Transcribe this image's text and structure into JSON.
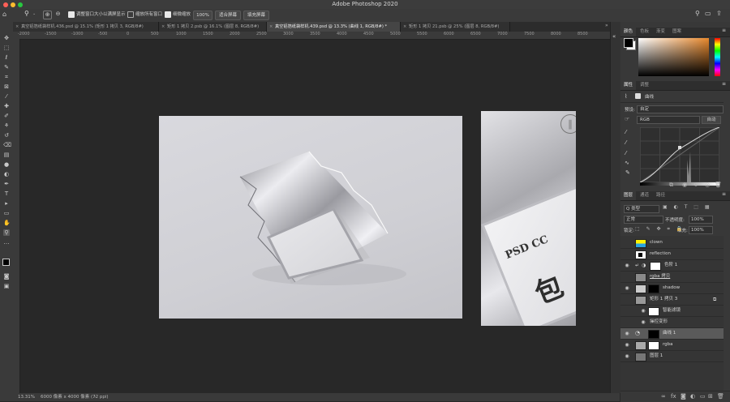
{
  "window": {
    "title": "Adobe Photoshop 2020"
  },
  "options_bar": {
    "resize_window_label": "调整窗口大小以满屏显示",
    "zoom_all_windows_label": "缩放所有窗口",
    "scrubby_zoom_label": "细微缩放",
    "zoom_value": "100%",
    "fit_screen_label": "适合屏幕",
    "fill_screen_label": "填充屏幕"
  },
  "tabs": [
    {
      "label": "真空铝箔纸袋样机.436.psd @ 15.1% (矩形 1 拷贝 3, RGB/8#)"
    },
    {
      "label": "矩形 1 拷贝 2.psb @ 16.1% (图层 8, RGB/8#)"
    },
    {
      "label": "真空铝箔纸袋样机.439.psd @ 13.3% (曲线 1, RGB/8#) *"
    },
    {
      "label": "矩形 1 拷贝 21.psb @ 25% (图层 8, RGB/8#)"
    }
  ],
  "ruler": {
    "top_ticks": [
      "-2000",
      "-1500",
      "-1000",
      "-500",
      "0",
      "500",
      "1000",
      "1500",
      "2000",
      "2500",
      "3000",
      "3500",
      "4000",
      "4500",
      "5000",
      "5500",
      "6000",
      "6500",
      "7000",
      "7500",
      "8000",
      "8500",
      "9000"
    ]
  },
  "status": {
    "zoom": "13.31%",
    "doc_info": "6000 像素 x 4000 像素 (72 ppi)"
  },
  "color_panel": {
    "tabs": [
      "颜色",
      "色板",
      "渐变",
      "图案"
    ]
  },
  "properties_panel": {
    "tabs": [
      "属性",
      "调整"
    ],
    "type_label": "曲线",
    "preset_label": "预设:",
    "preset_value": "自定",
    "channel_value": "RGB",
    "auto_label": "自动"
  },
  "layers_panel": {
    "tabs": [
      "图层",
      "通道",
      "路径"
    ],
    "filter_value": "Q 类型",
    "blend_mode": "正常",
    "opacity_label": "不透明度:",
    "opacity_value": "100%",
    "lock_label": "锁定:",
    "fill_label": "填充:",
    "fill_value": "100%",
    "layers": [
      {
        "name": "clown"
      },
      {
        "name": "reflection"
      },
      {
        "name": "色阶 1"
      },
      {
        "name": "rgba 拷贝"
      },
      {
        "name": "shadow"
      },
      {
        "name": "矩形 1 拷贝 3"
      },
      {
        "name": "智能滤镜"
      },
      {
        "name": "操控变形"
      },
      {
        "name": "曲线 1"
      },
      {
        "name": "rgba"
      },
      {
        "name": "图层 1"
      }
    ]
  },
  "artboard": {
    "brand_text": "PSD CC",
    "big_glyph": "包",
    "glyph_top": "∥"
  },
  "colors": {
    "accent_blue": "#2d8cf0",
    "panel_bg": "#383838",
    "canvas_bg": "#282828"
  }
}
